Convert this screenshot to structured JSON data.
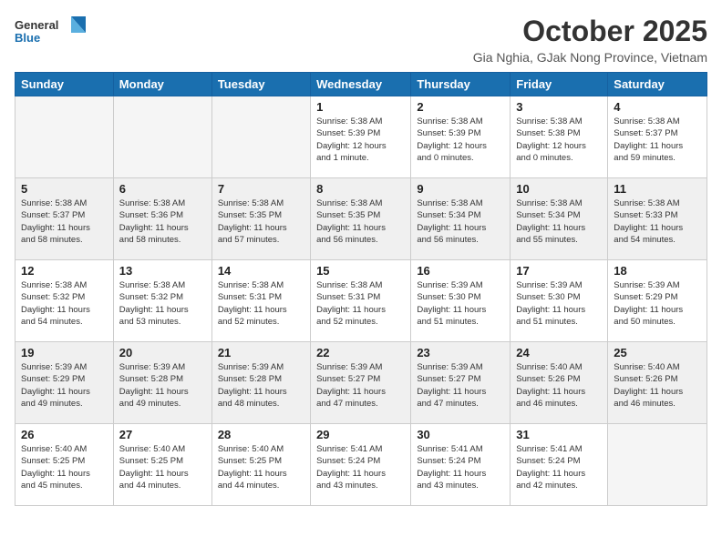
{
  "header": {
    "logo_general": "General",
    "logo_blue": "Blue",
    "month_title": "October 2025",
    "subtitle": "Gia Nghia, GJak Nong Province, Vietnam"
  },
  "weekdays": [
    "Sunday",
    "Monday",
    "Tuesday",
    "Wednesday",
    "Thursday",
    "Friday",
    "Saturday"
  ],
  "weeks": [
    [
      {
        "day": "",
        "info": ""
      },
      {
        "day": "",
        "info": ""
      },
      {
        "day": "",
        "info": ""
      },
      {
        "day": "1",
        "info": "Sunrise: 5:38 AM\nSunset: 5:39 PM\nDaylight: 12 hours\nand 1 minute."
      },
      {
        "day": "2",
        "info": "Sunrise: 5:38 AM\nSunset: 5:39 PM\nDaylight: 12 hours\nand 0 minutes."
      },
      {
        "day": "3",
        "info": "Sunrise: 5:38 AM\nSunset: 5:38 PM\nDaylight: 12 hours\nand 0 minutes."
      },
      {
        "day": "4",
        "info": "Sunrise: 5:38 AM\nSunset: 5:37 PM\nDaylight: 11 hours\nand 59 minutes."
      }
    ],
    [
      {
        "day": "5",
        "info": "Sunrise: 5:38 AM\nSunset: 5:37 PM\nDaylight: 11 hours\nand 58 minutes."
      },
      {
        "day": "6",
        "info": "Sunrise: 5:38 AM\nSunset: 5:36 PM\nDaylight: 11 hours\nand 58 minutes."
      },
      {
        "day": "7",
        "info": "Sunrise: 5:38 AM\nSunset: 5:35 PM\nDaylight: 11 hours\nand 57 minutes."
      },
      {
        "day": "8",
        "info": "Sunrise: 5:38 AM\nSunset: 5:35 PM\nDaylight: 11 hours\nand 56 minutes."
      },
      {
        "day": "9",
        "info": "Sunrise: 5:38 AM\nSunset: 5:34 PM\nDaylight: 11 hours\nand 56 minutes."
      },
      {
        "day": "10",
        "info": "Sunrise: 5:38 AM\nSunset: 5:34 PM\nDaylight: 11 hours\nand 55 minutes."
      },
      {
        "day": "11",
        "info": "Sunrise: 5:38 AM\nSunset: 5:33 PM\nDaylight: 11 hours\nand 54 minutes."
      }
    ],
    [
      {
        "day": "12",
        "info": "Sunrise: 5:38 AM\nSunset: 5:32 PM\nDaylight: 11 hours\nand 54 minutes."
      },
      {
        "day": "13",
        "info": "Sunrise: 5:38 AM\nSunset: 5:32 PM\nDaylight: 11 hours\nand 53 minutes."
      },
      {
        "day": "14",
        "info": "Sunrise: 5:38 AM\nSunset: 5:31 PM\nDaylight: 11 hours\nand 52 minutes."
      },
      {
        "day": "15",
        "info": "Sunrise: 5:38 AM\nSunset: 5:31 PM\nDaylight: 11 hours\nand 52 minutes."
      },
      {
        "day": "16",
        "info": "Sunrise: 5:39 AM\nSunset: 5:30 PM\nDaylight: 11 hours\nand 51 minutes."
      },
      {
        "day": "17",
        "info": "Sunrise: 5:39 AM\nSunset: 5:30 PM\nDaylight: 11 hours\nand 51 minutes."
      },
      {
        "day": "18",
        "info": "Sunrise: 5:39 AM\nSunset: 5:29 PM\nDaylight: 11 hours\nand 50 minutes."
      }
    ],
    [
      {
        "day": "19",
        "info": "Sunrise: 5:39 AM\nSunset: 5:29 PM\nDaylight: 11 hours\nand 49 minutes."
      },
      {
        "day": "20",
        "info": "Sunrise: 5:39 AM\nSunset: 5:28 PM\nDaylight: 11 hours\nand 49 minutes."
      },
      {
        "day": "21",
        "info": "Sunrise: 5:39 AM\nSunset: 5:28 PM\nDaylight: 11 hours\nand 48 minutes."
      },
      {
        "day": "22",
        "info": "Sunrise: 5:39 AM\nSunset: 5:27 PM\nDaylight: 11 hours\nand 47 minutes."
      },
      {
        "day": "23",
        "info": "Sunrise: 5:39 AM\nSunset: 5:27 PM\nDaylight: 11 hours\nand 47 minutes."
      },
      {
        "day": "24",
        "info": "Sunrise: 5:40 AM\nSunset: 5:26 PM\nDaylight: 11 hours\nand 46 minutes."
      },
      {
        "day": "25",
        "info": "Sunrise: 5:40 AM\nSunset: 5:26 PM\nDaylight: 11 hours\nand 46 minutes."
      }
    ],
    [
      {
        "day": "26",
        "info": "Sunrise: 5:40 AM\nSunset: 5:25 PM\nDaylight: 11 hours\nand 45 minutes."
      },
      {
        "day": "27",
        "info": "Sunrise: 5:40 AM\nSunset: 5:25 PM\nDaylight: 11 hours\nand 44 minutes."
      },
      {
        "day": "28",
        "info": "Sunrise: 5:40 AM\nSunset: 5:25 PM\nDaylight: 11 hours\nand 44 minutes."
      },
      {
        "day": "29",
        "info": "Sunrise: 5:41 AM\nSunset: 5:24 PM\nDaylight: 11 hours\nand 43 minutes."
      },
      {
        "day": "30",
        "info": "Sunrise: 5:41 AM\nSunset: 5:24 PM\nDaylight: 11 hours\nand 43 minutes."
      },
      {
        "day": "31",
        "info": "Sunrise: 5:41 AM\nSunset: 5:24 PM\nDaylight: 11 hours\nand 42 minutes."
      },
      {
        "day": "",
        "info": ""
      }
    ]
  ]
}
